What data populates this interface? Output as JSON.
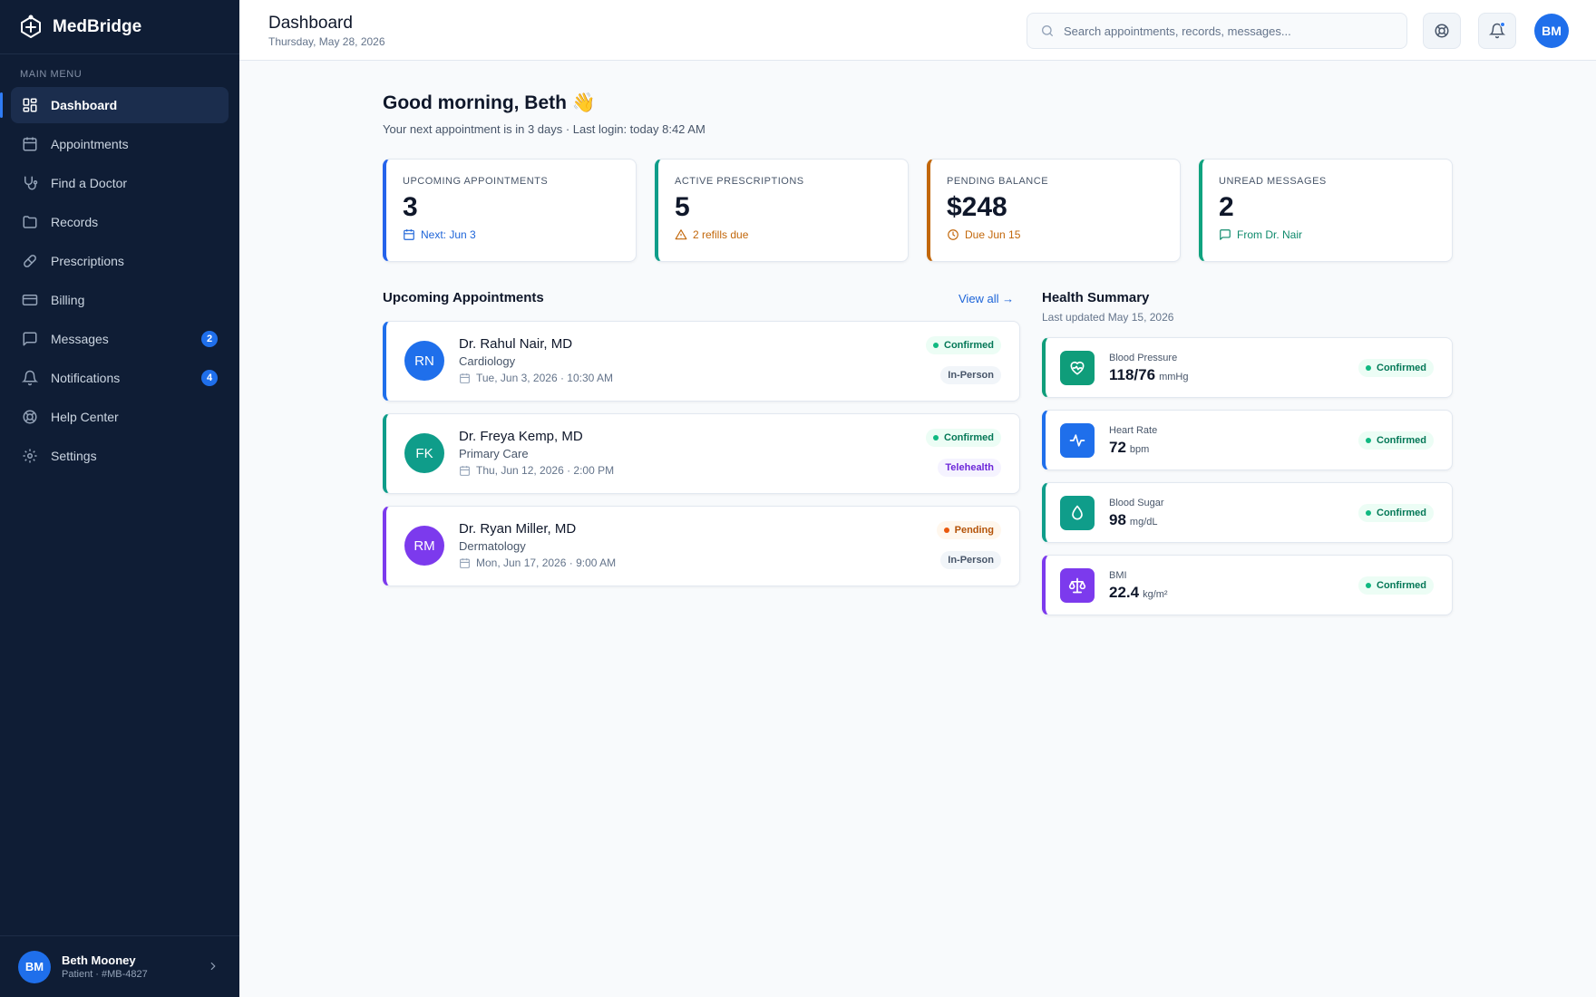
{
  "app": {
    "name": "MedBridge"
  },
  "sidebar": {
    "menu_title": "MAIN MENU",
    "items": [
      {
        "label": "Dashboard",
        "icon": "grid-icon",
        "active": true
      },
      {
        "label": "Appointments",
        "icon": "calendar-icon"
      },
      {
        "label": "Find a Doctor",
        "icon": "stethoscope-icon"
      },
      {
        "label": "Records",
        "icon": "folder-icon"
      },
      {
        "label": "Prescriptions",
        "icon": "pill-icon"
      },
      {
        "label": "Billing",
        "icon": "credit-card-icon"
      },
      {
        "label": "Messages",
        "icon": "message-icon",
        "badge": "2"
      },
      {
        "label": "Notifications",
        "icon": "bell-icon",
        "badge": "4"
      },
      {
        "label": "Help Center",
        "icon": "lifebuoy-icon"
      },
      {
        "label": "Settings",
        "icon": "gear-icon"
      }
    ],
    "user": {
      "initials": "BM",
      "name": "Beth Mooney",
      "meta": "Patient · #MB-4827"
    }
  },
  "header": {
    "title": "Dashboard",
    "date": "Thursday, May 28, 2026",
    "search_placeholder": "Search appointments, records, messages...",
    "avatar_initials": "BM"
  },
  "main": {
    "greeting": "Good morning, Beth 👋",
    "subtitle": "Your next appointment is in 3 days · Last login: today 8:42 AM",
    "stats": [
      {
        "label": "UPCOMING APPOINTMENTS",
        "value": "3",
        "foot": "Next: Jun 3",
        "icon": "calendar-icon",
        "accent": "#2563eb",
        "foot_color": "#1d64d8"
      },
      {
        "label": "ACTIVE PRESCRIPTIONS",
        "value": "5",
        "foot": "2 refills due",
        "icon": "warning-icon",
        "accent": "#0f9d8a",
        "foot_color": "#c2670a"
      },
      {
        "label": "PENDING BALANCE",
        "value": "$248",
        "foot": "Due Jun 15",
        "icon": "clock-icon",
        "accent": "#c2670a",
        "foot_color": "#c2670a"
      },
      {
        "label": "UNREAD MESSAGES",
        "value": "2",
        "foot": "From Dr. Nair",
        "icon": "message-icon",
        "accent": "#10a37f",
        "foot_color": "#0f8a6c"
      }
    ],
    "appointments_title": "Upcoming Appointments",
    "view_all": "View all →",
    "appointments": [
      {
        "initials": "RN",
        "doctor": "Dr. Rahul Nair, MD",
        "specialty": "Cardiology",
        "when": "Tue, Jun 3, 2026 · 10:30 AM",
        "status": "Confirmed",
        "type": "In-Person",
        "color": "#1f6feb"
      },
      {
        "initials": "FK",
        "doctor": "Dr. Freya Kemp, MD",
        "specialty": "Primary Care",
        "when": "Thu, Jun 12, 2026 · 2:00 PM",
        "status": "Confirmed",
        "type": "Telehealth",
        "color": "#0f9d8a"
      },
      {
        "initials": "RM",
        "doctor": "Dr. Ryan Miller, MD",
        "specialty": "Dermatology",
        "when": "Mon, Jun 17, 2026 · 9:00 AM",
        "status": "Pending",
        "type": "In-Person",
        "color": "#7c3aed"
      }
    ],
    "health_title": "Health Summary",
    "health_updated": "Last updated May 15, 2026",
    "vitals": [
      {
        "name": "Blood Pressure",
        "value": "118/76",
        "unit": "mmHg",
        "status": "Confirmed",
        "icon": "heart-icon",
        "color": "#0f9d7a"
      },
      {
        "name": "Heart Rate",
        "value": "72",
        "unit": "bpm",
        "status": "Confirmed",
        "icon": "pulse-icon",
        "color": "#1f6feb"
      },
      {
        "name": "Blood Sugar",
        "value": "98",
        "unit": "mg/dL",
        "status": "Confirmed",
        "icon": "droplet-icon",
        "color": "#0f9d8a"
      },
      {
        "name": "BMI",
        "value": "22.4",
        "unit": "kg/m²",
        "status": "Confirmed",
        "icon": "scale-icon",
        "color": "#7c3aed"
      }
    ]
  }
}
